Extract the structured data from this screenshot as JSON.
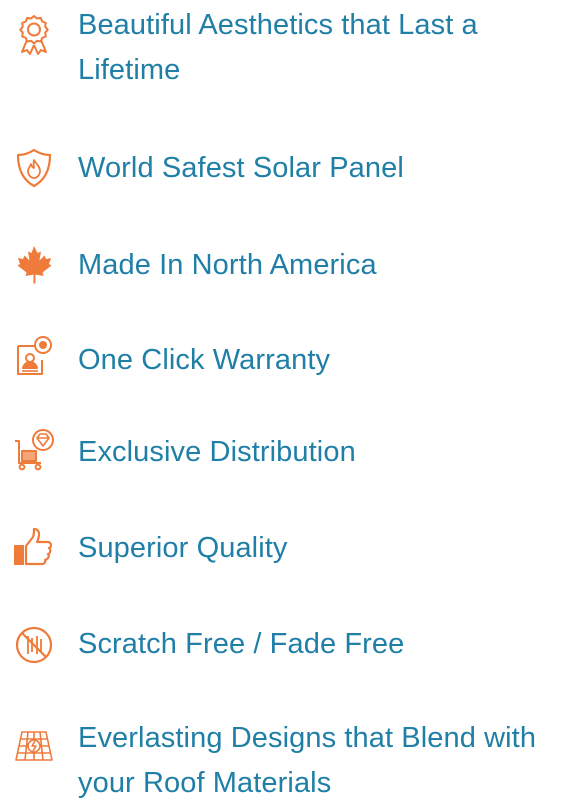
{
  "colors": {
    "text": "#1f7fa7",
    "icon": "#ef7b3b",
    "background": "#ffffff"
  },
  "features": [
    {
      "icon": "award-ribbon-icon",
      "label": "Beautiful Aesthetics that Last a Lifetime"
    },
    {
      "icon": "fire-shield-icon",
      "label": "World Safest Solar Panel"
    },
    {
      "icon": "maple-leaf-icon",
      "label": "Made In North America"
    },
    {
      "icon": "warranty-certificate-icon",
      "label": "One Click Warranty"
    },
    {
      "icon": "diamond-cart-icon",
      "label": "Exclusive Distribution"
    },
    {
      "icon": "thumbs-up-icon",
      "label": "Superior Quality"
    },
    {
      "icon": "no-scratch-icon",
      "label": "Scratch Free / Fade Free"
    },
    {
      "icon": "roof-solar-icon",
      "label": "Everlasting Designs that Blend with your Roof Materials"
    }
  ]
}
